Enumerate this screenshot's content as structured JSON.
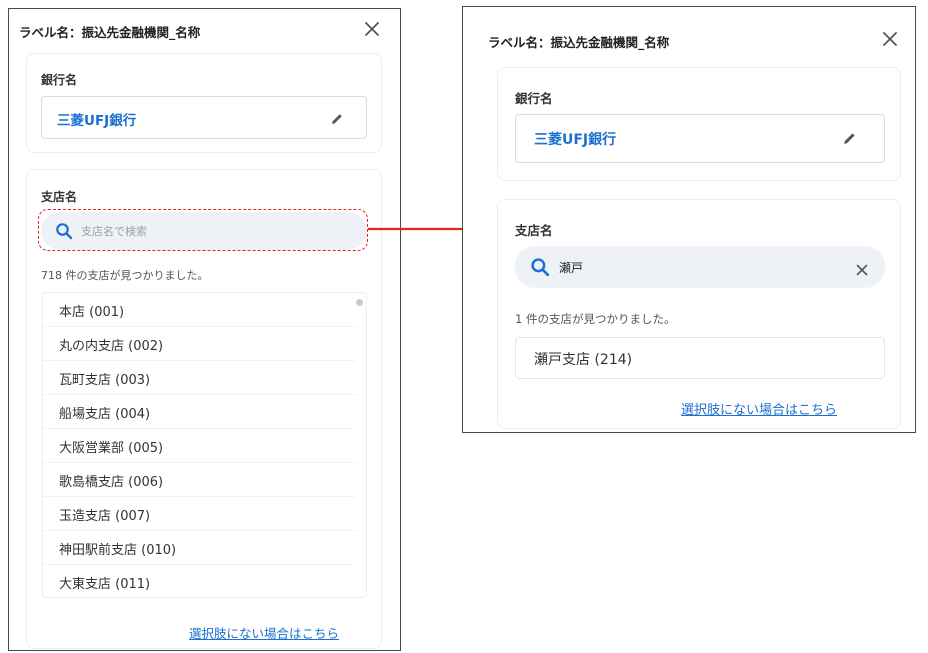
{
  "left": {
    "title": "ラベル名：振込先金融機関_名称",
    "bank_label": "銀行名",
    "bank_name": "三菱UFJ銀行",
    "branch_label": "支店名",
    "search_placeholder": "支店名で検索",
    "count_text": "718 件の支店が見つかりました。",
    "branches": [
      {
        "label": "本店 (001)"
      },
      {
        "label": "丸の内支店 (002)"
      },
      {
        "label": "瓦町支店 (003)"
      },
      {
        "label": "船場支店 (004)"
      },
      {
        "label": "大阪営業部 (005)"
      },
      {
        "label": "歌島橋支店 (006)"
      },
      {
        "label": "玉造支店 (007)"
      },
      {
        "label": "神田駅前支店 (010)"
      },
      {
        "label": "大東支店 (011)"
      }
    ],
    "link_text": "選択肢にない場合はこちら"
  },
  "right": {
    "title": "ラベル名：振込先金融機関_名称",
    "bank_label": "銀行名",
    "bank_name": "三菱UFJ銀行",
    "branch_label": "支店名",
    "search_value": "瀬戸",
    "count_text": "1 件の支店が見つかりました。",
    "result": "瀬戸支店 (214)",
    "link_text": "選択肢にない場合はこちら"
  },
  "colors": {
    "accent": "#1d6fd0",
    "highlight": "#e02424",
    "search_bg": "#eef1f5"
  },
  "icons": [
    "close-icon",
    "pencil-icon",
    "search-icon",
    "clear-icon",
    "arrow-right-icon"
  ]
}
